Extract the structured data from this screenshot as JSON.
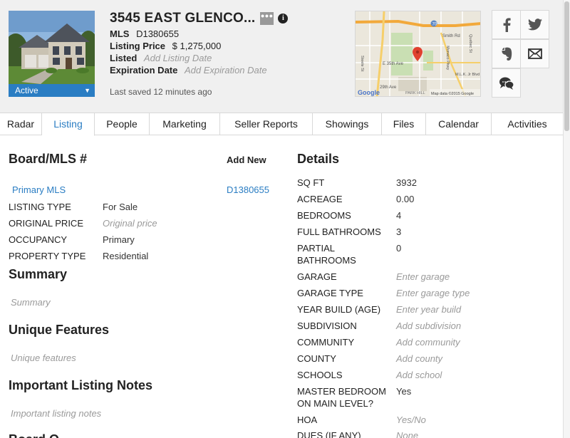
{
  "header": {
    "address": "3545 EAST GLENCO...",
    "more_label": "•••",
    "info_label": "i",
    "status": "Active",
    "mls_label": "MLS",
    "mls_value": "D1380655",
    "price_label": "Listing Price",
    "price_value": "$ 1,275,000",
    "listed_label": "Listed",
    "listed_placeholder": "Add Listing Date",
    "expiration_label": "Expiration Date",
    "expiration_placeholder": "Add Expiration Date",
    "last_saved": "Last saved 12 minutes ago"
  },
  "map": {
    "street_labels": [
      "Smith Rd",
      "E 35th Ave",
      "29th Ave",
      "PARK HILL",
      "Steele St",
      "M.L.K. Jr Blvd",
      "Monaco Pkwy",
      "Quebec St",
      "70"
    ],
    "attribution": "Map data ©2015 Google",
    "logo": "Google"
  },
  "social": {
    "icons": [
      "facebook-icon",
      "twitter-icon",
      "evernote-icon",
      "email-icon",
      "chat-icon"
    ]
  },
  "tabs": [
    {
      "label": "Radar"
    },
    {
      "label": "Listing"
    },
    {
      "label": "People"
    },
    {
      "label": "Marketing"
    },
    {
      "label": "Seller Reports"
    },
    {
      "label": "Showings"
    },
    {
      "label": "Files"
    },
    {
      "label": "Calendar"
    },
    {
      "label": "Activities"
    }
  ],
  "active_tab": "Listing",
  "board": {
    "title": "Board/MLS #",
    "add_new": "Add New",
    "mls_name": "Primary MLS",
    "mls_number": "D1380655",
    "fields": [
      {
        "label": "LISTING TYPE",
        "value": "For Sale"
      },
      {
        "label": "ORIGINAL PRICE",
        "value": "Original price"
      },
      {
        "label": "OCCUPANCY",
        "value": "Primary"
      },
      {
        "label": "PROPERTY TYPE",
        "value": "Residential"
      }
    ]
  },
  "summary": {
    "title": "Summary",
    "placeholder": "Summary"
  },
  "features": {
    "title": "Unique Features",
    "placeholder": "Unique features"
  },
  "notes": {
    "title": "Important Listing Notes",
    "placeholder": "Important listing notes"
  },
  "next_section": {
    "title": "Board O..."
  },
  "details": {
    "title": "Details",
    "fields": [
      {
        "label": "SQ FT",
        "value": "3932"
      },
      {
        "label": "ACREAGE",
        "value": "0.00"
      },
      {
        "label": "BEDROOMS",
        "value": "4"
      },
      {
        "label": "FULL BATHROOMS",
        "value": "3"
      },
      {
        "label": "PARTIAL",
        "label2": "BATHROOMS",
        "value": "0"
      },
      {
        "label": "GARAGE",
        "value": "Enter garage"
      },
      {
        "label": "GARAGE TYPE",
        "value": "Enter garage type"
      },
      {
        "label": "YEAR BUILD (AGE)",
        "value": "Enter year build"
      },
      {
        "label": "SUBDIVISION",
        "value": "Add subdivision"
      },
      {
        "label": "COMMUNITY",
        "value": "Add community"
      },
      {
        "label": "COUNTY",
        "value": "Add county"
      },
      {
        "label": "SCHOOLS",
        "value": "Add school"
      },
      {
        "label": "MASTER BEDROOM",
        "label2": "ON MAIN LEVEL?",
        "value": "Yes"
      },
      {
        "label": "HOA",
        "value": "Yes/No"
      },
      {
        "label": "DUES (IF ANY)",
        "value": "None"
      }
    ]
  },
  "colors": {
    "accent": "#2a7dc3",
    "header_bg": "#f0f0f0"
  }
}
